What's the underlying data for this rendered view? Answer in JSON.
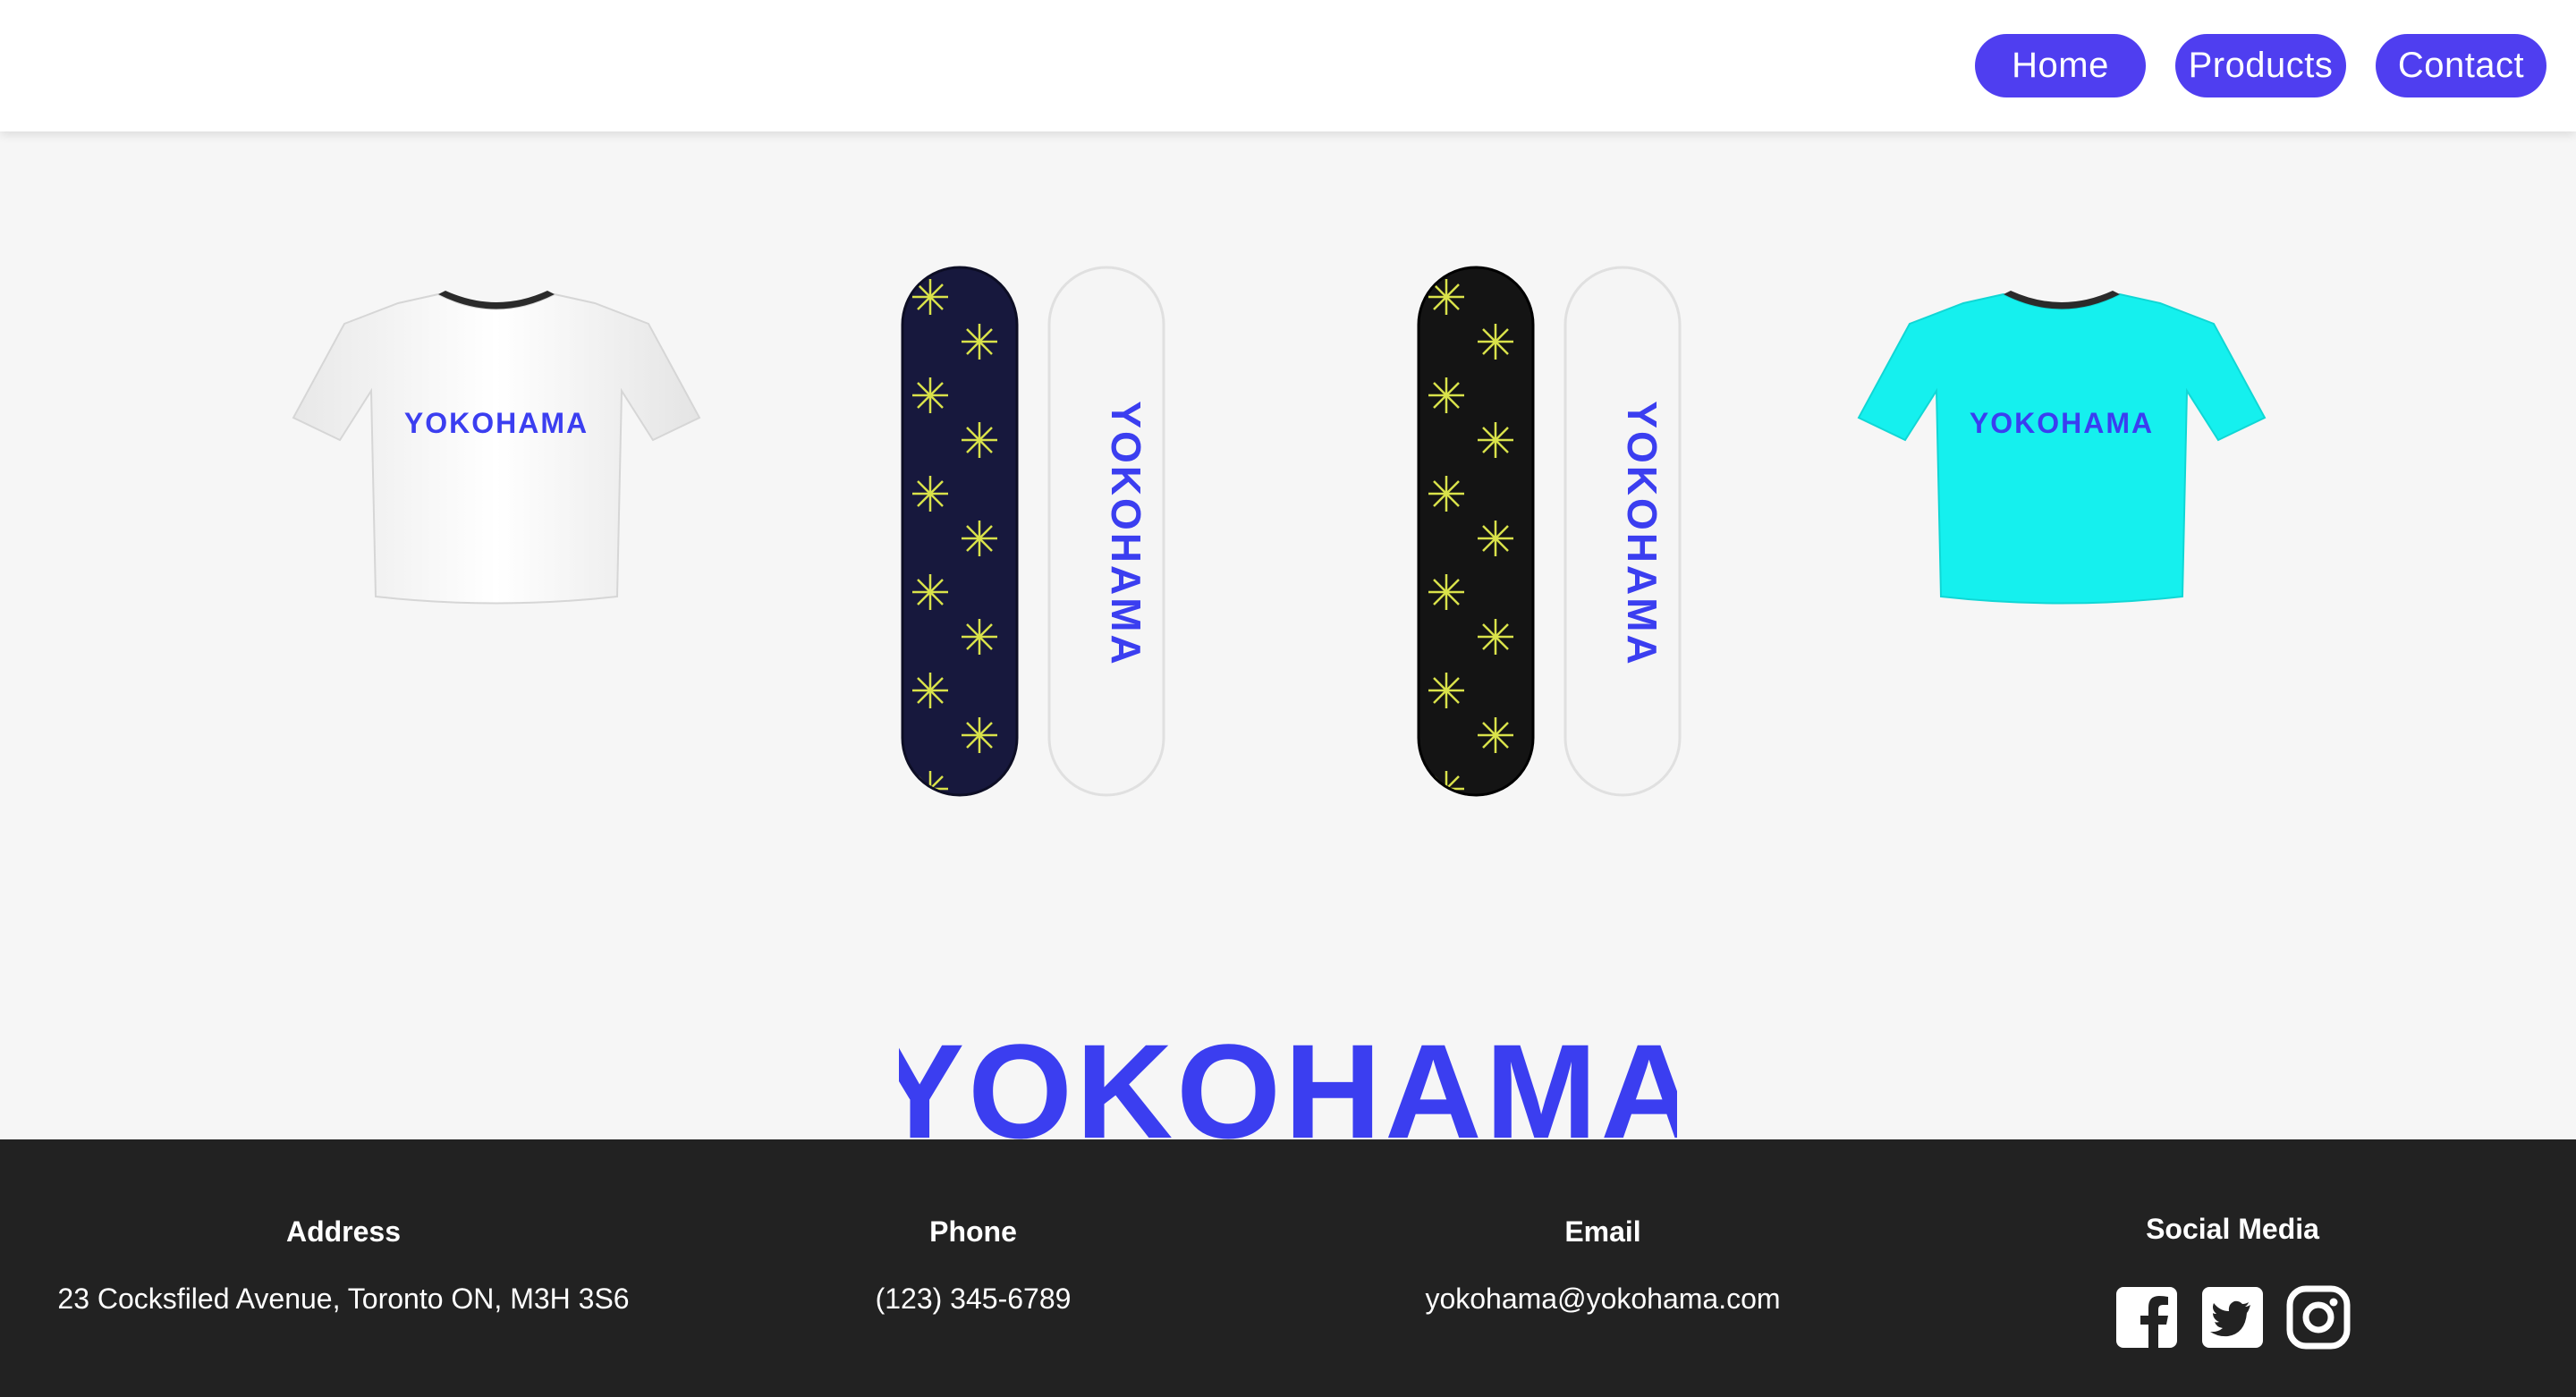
{
  "nav": {
    "home_label": "Home",
    "products_label": "Products",
    "contact_label": "Contact"
  },
  "hero": {
    "products": [
      {
        "name": "white-tshirt",
        "color": "#ffffff",
        "print": "YOKOHAMA"
      },
      {
        "name": "navy-snowboard-pair",
        "deck_color": "#17183d",
        "base_color": "#f4f4f4",
        "print": "YOKOHAMA"
      },
      {
        "name": "black-snowboard-pair",
        "deck_color": "#141414",
        "base_color": "#f4f4f4",
        "print": "YOKOHAMA"
      },
      {
        "name": "cyan-tshirt",
        "color": "#15f0ee",
        "print": "YOKOHAMA"
      }
    ],
    "wordmark": "YOKOHAMA",
    "brand_color": "#3b3ef0"
  },
  "footer": {
    "address_heading": "Address",
    "address_value": "23 Cocksfiled Avenue, Toronto ON, M3H 3S6",
    "phone_heading": "Phone",
    "phone_value": "(123) 345-6789",
    "email_heading": "Email",
    "email_value": "yokohama@yokohama.com",
    "social_heading": "Social Media",
    "social_icons": [
      "facebook-icon",
      "twitter-icon",
      "instagram-icon"
    ]
  },
  "colors": {
    "nav_button": "#4f3ef0",
    "footer_bg": "#222222",
    "page_bg": "#f6f6f6"
  }
}
